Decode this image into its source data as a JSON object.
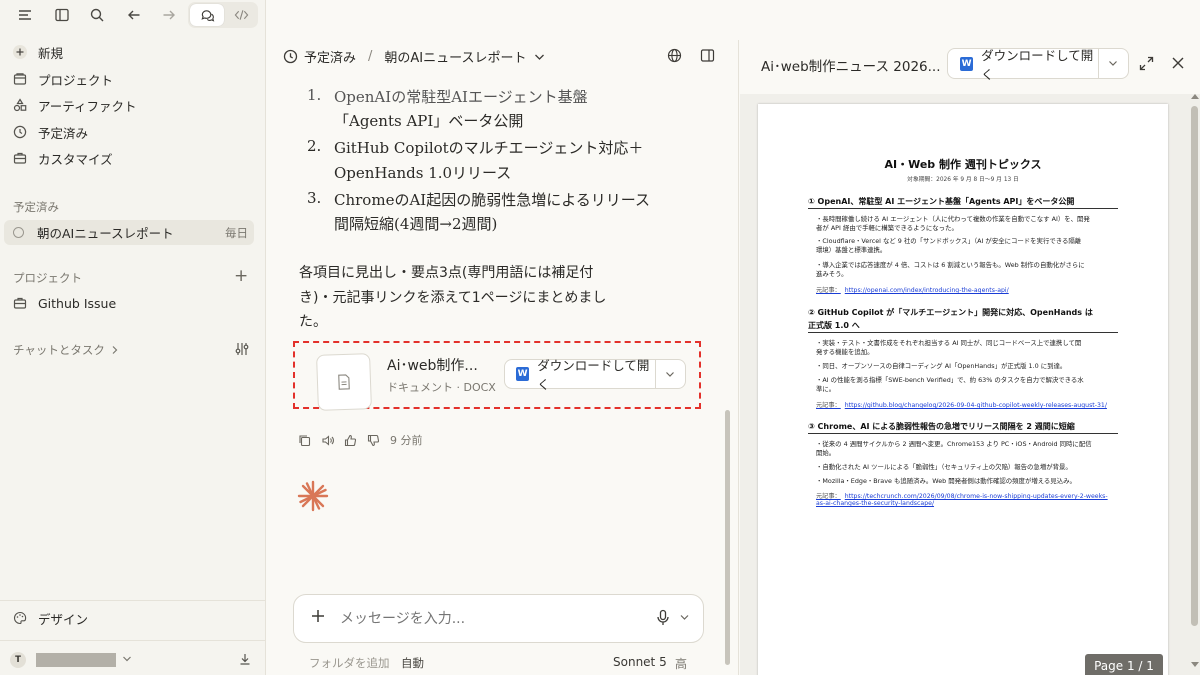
{
  "sidebar": {
    "items": [
      {
        "label": "新規"
      },
      {
        "label": "プロジェクト"
      },
      {
        "label": "アーティファクト"
      },
      {
        "label": "予定済み"
      },
      {
        "label": "カスタマイズ"
      }
    ],
    "scheduled_header": "予定済み",
    "scheduled_item": {
      "label": "朝のAIニュースレポート",
      "badge": "毎日"
    },
    "projects_header": "プロジェクト",
    "projects_add": "+",
    "project_item": "Github Issue",
    "chats_header": "チャットとタスク",
    "design_label": "デザイン",
    "user_initial": "T"
  },
  "header": {
    "breadcrumb_parent": "予定済み",
    "separator": "/",
    "title": "朝のAIニュースレポート"
  },
  "message": {
    "list": [
      {
        "num": "1.",
        "lines": [
          "OpenAIの常駐型AIエージェント基盤",
          "「Agents API」ベータ公開"
        ]
      },
      {
        "num": "2.",
        "lines": [
          "GitHub Copilotのマルチエージェント対応＋",
          "OpenHands 1.0リリース"
        ]
      },
      {
        "num": "3.",
        "lines": [
          "ChromeのAI起因の脆弱性急増によるリリース",
          "間隔短縮(4週間→2週間)"
        ]
      }
    ],
    "paragraph": [
      "各項目に見出し・要点3点(専門用語には補足付",
      "き)・元記事リンクを添えて1ページにまとめまし",
      "た。"
    ],
    "attachment": {
      "title": "Ai･web制作...",
      "meta": "ドキュメント · DOCX",
      "button": "ダウンロードして開く"
    },
    "time": "9 分前"
  },
  "composer": {
    "placeholder": "メッセージを入力...",
    "add_folder": "フォルダを追加",
    "mode": "自動",
    "model": "Sonnet 5",
    "effort": "高"
  },
  "doc_panel": {
    "title": "Ai･web制作ニュース 2026...",
    "button": "ダウンロードして開く",
    "page_indicator": "Page 1 / 1",
    "content": {
      "title": "AI・Web 制作 週刊トピックス",
      "subtitle": "対象期間：2026 年 9 月 8 日〜9 月 13 日",
      "sections": [
        {
          "heading": [
            "① OpenAI、常駐型 AI エージェント基盤「Agents API」をベータ公開"
          ],
          "bullets": [
            [
              "・長時間稼働し続ける AI エージェント（人に代わって複数の作業を自動でこなす AI）を、開発",
              "者が API 経由で手軽に構築できるようになった。"
            ],
            [
              "・Cloudflare・Vercel など 9 社の「サンドボックス」（AI が安全にコードを実行できる隔離",
              "環境）基盤と標準連携。"
            ],
            [
              "・導入企業では応答速度が 4 倍、コストは 6 割減という報告も。Web 制作の自動化がさらに",
              "進みそう。"
            ]
          ],
          "source_label": "元記事：",
          "link": [
            "https://openai.com/index/introducing-the-agents-api/"
          ]
        },
        {
          "heading": [
            "② GitHub Copilot が「マルチエージェント」開発に対応、OpenHands は",
            "正式版 1.0 へ"
          ],
          "bullets": [
            [
              "・実装・テスト・文書作成をそれぞれ担当する AI 同士が、同じコードベース上で連携して開",
              "発する機能を追加。"
            ],
            [
              "・同日、オープンソースの自律コーディング AI「OpenHands」が正式版 1.0 に到達。"
            ],
            [
              "・AI の性能を測る指標「SWE-bench Verified」で、約 63% のタスクを自力で解決できる水",
              "準に。"
            ]
          ],
          "source_label": "元記事：",
          "link": [
            "https://github.blog/changelog/2026-09-04-github-copilot-weekly-releases-august-31/"
          ]
        },
        {
          "heading": [
            "③ Chrome、AI による脆弱性報告の急増でリリース間隔を 2 週間に短縮"
          ],
          "bullets": [
            [
              "・従来の 4 週間サイクルから 2 週間へ変更。Chrome153 より PC・iOS・Android 同時に配信",
              "開始。"
            ],
            [
              "・自動化された AI ツールによる「脆弱性」（セキュリティ上の欠陥）報告の急増が背景。"
            ],
            [
              "・Mozilla・Edge・Brave も追随済み。Web 開発者側は動作確認の頻度が増える見込み。"
            ]
          ],
          "source_label": "元記事：",
          "link": [
            "https://techcrunch.com/2026/09/08/chrome-is-now-shipping-updates-every-2-weeks-",
            "as-ai-changes-the-security-landscape/"
          ]
        }
      ]
    }
  },
  "colors": {
    "accent": "#d97757",
    "highlight_border": "#e3312b",
    "word_blue": "#2b6bd6",
    "link": "#1a3dd6"
  }
}
